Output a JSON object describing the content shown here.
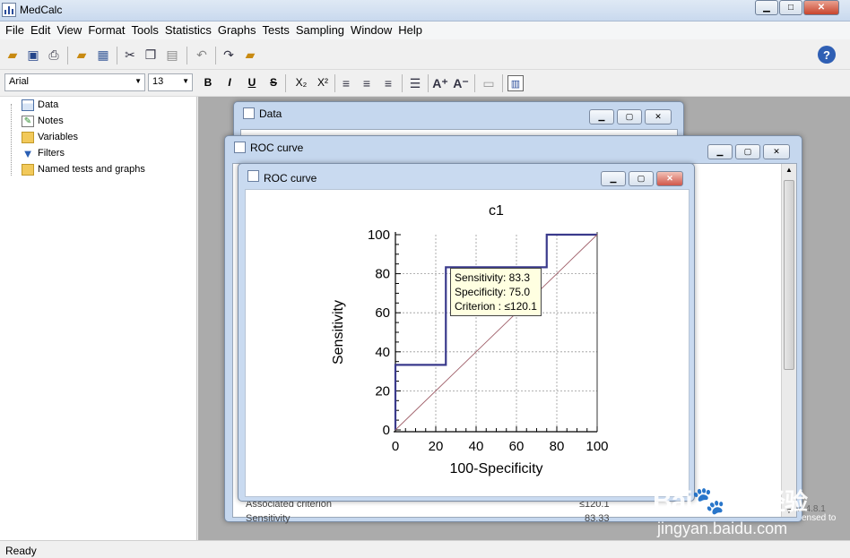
{
  "app": {
    "title": "MedCalc"
  },
  "menu": [
    "File",
    "Edit",
    "View",
    "Format",
    "Tools",
    "Statistics",
    "Graphs",
    "Tests",
    "Sampling",
    "Window",
    "Help"
  ],
  "format_toolbar": {
    "font": "Arial",
    "size": "13",
    "bold": "B",
    "italic": "I",
    "underline": "U",
    "strike": "S",
    "subscript": "X₂",
    "superscript": "X²"
  },
  "tree": {
    "items": [
      "Data",
      "Notes",
      "Variables",
      "Filters",
      "Named tests and graphs"
    ]
  },
  "windows": {
    "data_title": "Data",
    "roc_outer_title": "ROC curve",
    "roc_inner_title": "ROC curve",
    "bottom_row_label_1": "Associated criterion",
    "bottom_row_value_1": "≤120.1",
    "bottom_row_label_2": "Sensitivity",
    "bottom_row_value_2": "83.33",
    "right_text_1": "v14.8.1",
    "right_text_2": "ensed to"
  },
  "tooltip": {
    "line1": "Sensitivity: 83.3",
    "line2": "Specificity: 75.0",
    "line3": "Criterion : ≤120.1"
  },
  "status": {
    "text": "Ready"
  },
  "watermark": {
    "line1": "Bai",
    "line2": "du",
    "cn": "经验",
    "url": "jingyan.baidu.com"
  },
  "chart_data": {
    "type": "line",
    "title": "c1",
    "xlabel": "100-Specificity",
    "ylabel": "Sensitivity",
    "xlim": [
      0,
      100
    ],
    "ylim": [
      0,
      100
    ],
    "xticks": [
      0,
      20,
      40,
      60,
      80,
      100
    ],
    "yticks": [
      0,
      20,
      40,
      60,
      80,
      100
    ],
    "grid": true,
    "series": [
      {
        "x": [
          0,
          0,
          25,
          25,
          75,
          75,
          100
        ],
        "y": [
          0,
          33.3,
          33.3,
          83.3,
          83.3,
          100,
          100
        ],
        "color": "#3a3a8c"
      },
      {
        "x": [
          0,
          100
        ],
        "y": [
          0,
          100
        ],
        "color": "#a0606a",
        "style": "diagonal"
      }
    ],
    "highlight": {
      "x": 25,
      "y": 83.3
    }
  }
}
